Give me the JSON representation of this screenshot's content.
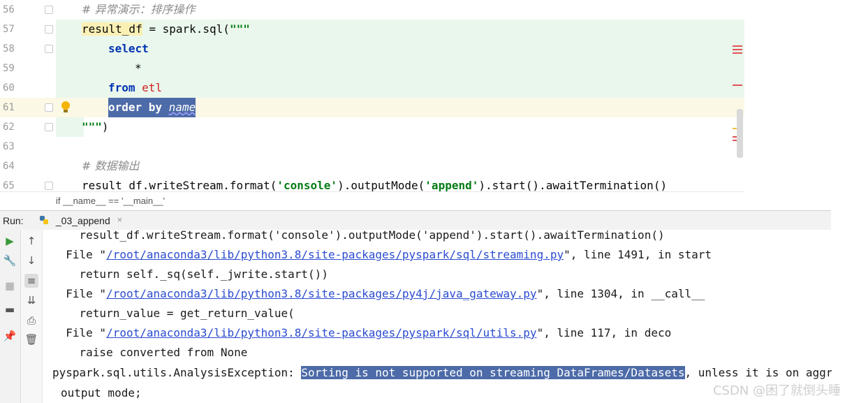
{
  "editor": {
    "lines": [
      {
        "n": "56",
        "comment": "# 异常演示：排序操作"
      },
      {
        "n": "57",
        "a": "result_df",
        "b": " = spark.sql(",
        "c": "\"\"\""
      },
      {
        "n": "58",
        "kw": "select"
      },
      {
        "n": "59",
        "star": "*"
      },
      {
        "n": "60",
        "kw": "from",
        "tbl": "etl"
      },
      {
        "n": "61",
        "kw": "order by",
        "it": "name"
      },
      {
        "n": "62",
        "str": "\"\"\"",
        "close": ")"
      },
      {
        "n": "63"
      },
      {
        "n": "64",
        "comment": "# 数据输出"
      },
      {
        "n": "65",
        "a": "result_df.writeStream.format(",
        "s1": "'console'",
        "b": ").outputMode(",
        "s2": "'append'",
        "c": ").start().awaitTermination()"
      }
    ],
    "breadcrumb": "if __name__ == '__main__'"
  },
  "run": {
    "label": "Run:",
    "tab": "_03_append",
    "close": "×"
  },
  "console": {
    "l1": "    result_df.writeStream.format('console').outputMode('append').start().awaitTermination()",
    "l2a": "  File \"",
    "l2link": "/root/anaconda3/lib/python3.8/site-packages/pyspark/sql/streaming.py",
    "l2b": "\", line 1491, in start",
    "l3": "    return self._sq(self._jwrite.start())",
    "l4a": "  File \"",
    "l4link": "/root/anaconda3/lib/python3.8/site-packages/py4j/java_gateway.py",
    "l4b": "\", line 1304, in __call__",
    "l5": "    return_value = get_return_value(",
    "l6a": "  File \"",
    "l6link": "/root/anaconda3/lib/python3.8/site-packages/pyspark/sql/utils.py",
    "l6b": "\", line 117, in deco",
    "l7": "    raise converted from None",
    "l8a": "pyspark.sql.utils.AnalysisException: ",
    "l8sel": "Sorting is not supported on streaming DataFrames/Datasets",
    "l8b": ", unless it is on aggr",
    "l9": "output mode;"
  },
  "watermark": "CSDN @困了就倒头睡",
  "colors": {
    "selection": "#4d6ba8",
    "changed": "#eaf7ec",
    "keyword": "#0033b3",
    "string": "#067d17"
  }
}
